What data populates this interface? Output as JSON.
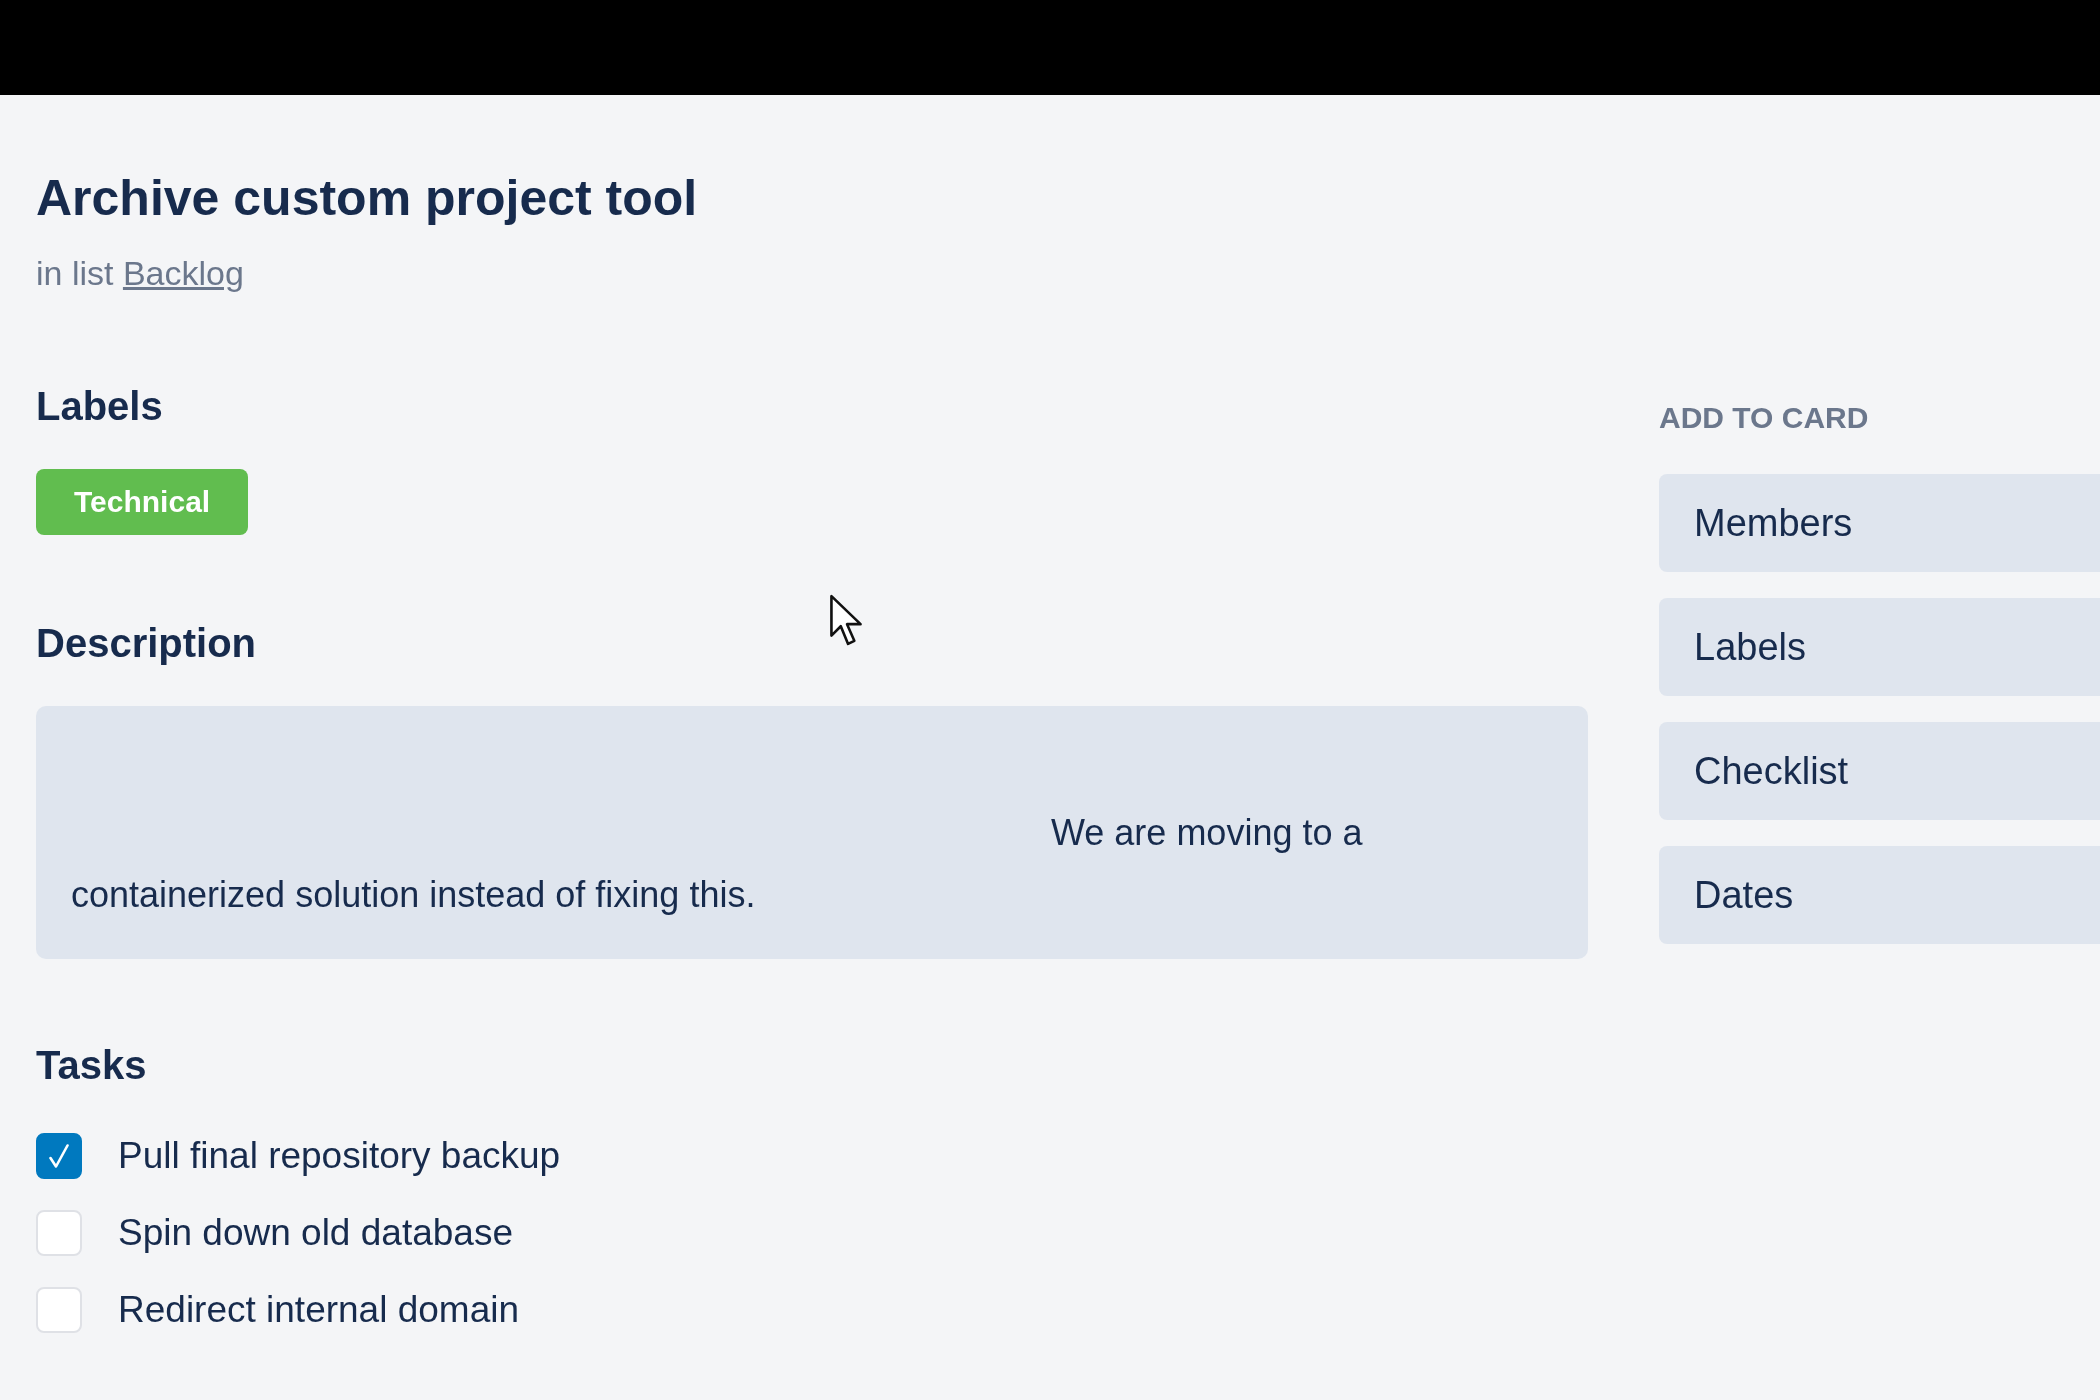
{
  "card": {
    "title": "Archive custom project tool",
    "list_prefix": "in list",
    "list_name": "Backlog"
  },
  "labels_section": {
    "heading": "Labels",
    "labels": [
      {
        "name": "Technical",
        "color": "#61bd4f"
      }
    ]
  },
  "description": {
    "heading": "Description",
    "text": "We are moving to a containerized solution instead of fixing this."
  },
  "tasks": {
    "heading": "Tasks",
    "items": [
      {
        "text": "Pull final repository backup",
        "checked": true
      },
      {
        "text": "Spin down old database",
        "checked": false
      },
      {
        "text": "Redirect internal domain",
        "checked": false
      }
    ]
  },
  "sidebar": {
    "heading": "ADD TO CARD",
    "buttons": [
      "Members",
      "Labels",
      "Checklist",
      "Dates"
    ]
  }
}
